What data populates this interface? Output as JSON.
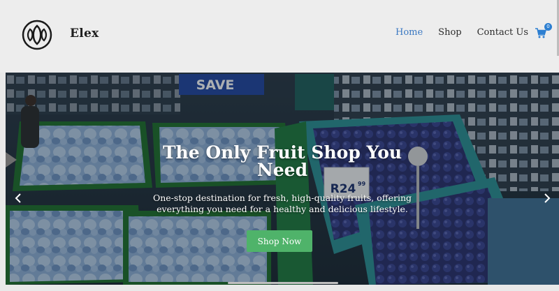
{
  "header": {
    "brand": "Elex",
    "nav": [
      {
        "label": "Home",
        "active": true
      },
      {
        "label": "Shop",
        "active": false
      },
      {
        "label": "Contact Us",
        "active": false
      }
    ],
    "cart_count": "0"
  },
  "hero": {
    "title": "The Only Fruit Shop You Need",
    "subtitle": "One-stop destination for fresh, high-quality fruits, offering everything you need for a healthy and delicious lifestyle.",
    "cta_label": "Shop Now",
    "sign_save": "SAVE",
    "price_tag": "R24",
    "price_cents": "99"
  },
  "colors": {
    "accent": "#3a78c2",
    "button": "#4fb36a",
    "badge": "#2d7fd1"
  },
  "icons": {
    "logo": "brand-logo-icon",
    "cart": "cart-icon",
    "prev": "chevron-left-icon",
    "next": "chevron-right-icon"
  }
}
